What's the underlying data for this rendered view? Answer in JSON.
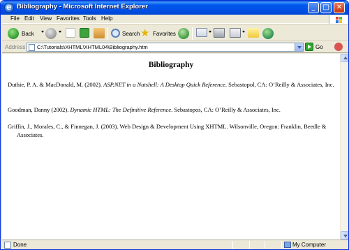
{
  "window": {
    "title": "Bibliography - Microsoft Internet Explorer"
  },
  "menu": [
    "File",
    "Edit",
    "View",
    "Favorites",
    "Tools",
    "Help"
  ],
  "toolbar": {
    "back": "Back",
    "search": "Search",
    "favorites": "Favorites"
  },
  "address": {
    "label": "Address",
    "url": "C:\\Tutorials\\XHTML\\XHTML04\\Bibliography.htm",
    "go": "Go"
  },
  "page": {
    "heading": "Bibliography",
    "entries": [
      {
        "before": "Duthie, P. A. & MacDonald, M. (2002). ",
        "title": "ASP.NET in a Nutshell: A Desktop Quick Reference",
        "after": ". Sebastopol, CA: O’Reilly & Associates, Inc."
      },
      {
        "before": "Goodman, Danny (2002). ",
        "title": "Dynamic HTML: The Definitive Reference",
        "after": ". Sebastopos, CA: O’Reilly & Associates, Inc."
      },
      {
        "before": "Griffin, J., Morales, C., & Finnegan, J. (2003). Web Design & Development Using XHTML. Wilsonville, Oregon: Franklin, Beedle & Associates.",
        "title": "",
        "after": ""
      }
    ]
  },
  "status": {
    "text": "Done",
    "zone": "My Computer"
  },
  "colors": {
    "titlebar": "#0058ee",
    "chrome": "#ece9d8"
  },
  "icons": [
    "ie-logo-icon",
    "back-arrow-icon",
    "forward-arrow-icon",
    "stop-icon",
    "refresh-icon",
    "home-icon",
    "search-icon",
    "favorites-star-icon",
    "history-icon",
    "mail-icon",
    "print-icon",
    "edit-icon",
    "messenger-icon",
    "page-icon",
    "go-arrow-icon",
    "computer-icon"
  ]
}
